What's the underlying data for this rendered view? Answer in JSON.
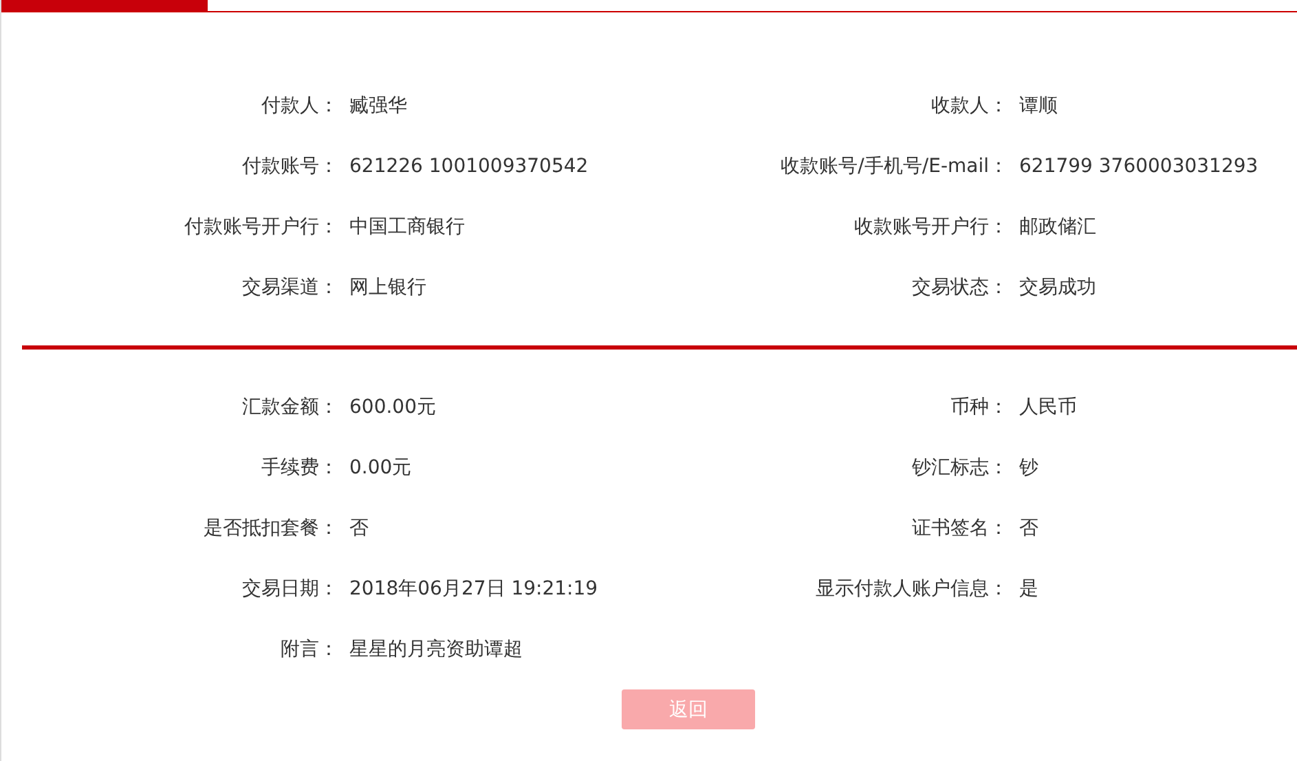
{
  "sections": [
    {
      "fields": [
        {
          "label": "付款人：",
          "value": "臧强华"
        },
        {
          "label": "收款人：",
          "value": "谭顺"
        },
        {
          "label": "付款账号：",
          "value": "621226 1001009370542"
        },
        {
          "label": "收款账号/手机号/E-mail：",
          "value": "621799 3760003031293"
        },
        {
          "label": "付款账号开户行：",
          "value": "中国工商银行"
        },
        {
          "label": "收款账号开户行：",
          "value": "邮政储汇"
        },
        {
          "label": "交易渠道：",
          "value": "网上银行"
        },
        {
          "label": "交易状态：",
          "value": "交易成功"
        }
      ]
    },
    {
      "fields": [
        {
          "label": "汇款金额：",
          "value": "600.00元"
        },
        {
          "label": "币种：",
          "value": "人民币"
        },
        {
          "label": "手续费：",
          "value": "0.00元"
        },
        {
          "label": "钞汇标志：",
          "value": "钞"
        },
        {
          "label": "是否抵扣套餐：",
          "value": "否"
        },
        {
          "label": "证书签名：",
          "value": "否"
        },
        {
          "label": "交易日期：",
          "value": "2018年06月27日 19:21:19"
        },
        {
          "label": "显示付款人账户信息：",
          "value": "是"
        },
        {
          "label": "附言：",
          "value": "星星的月亮资助谭超"
        }
      ]
    }
  ],
  "button": {
    "label": "返回"
  }
}
